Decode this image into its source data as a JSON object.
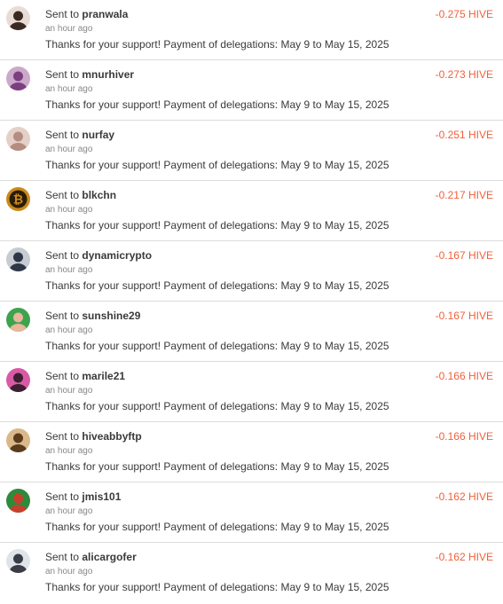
{
  "colors": {
    "amount": "#f0603c",
    "divider": "#dcdcdc"
  },
  "transactions": [
    {
      "prefix": "Sent to",
      "user": "pranwala",
      "time": "an hour ago",
      "memo": "Thanks for your support! Payment of delegations: May 9 to May 15, 2025",
      "amount": "-0.275 HIVE",
      "avatar_icon": "avatar-person-icon",
      "avatar_colors": [
        "#e8ddd5",
        "#3a2a22"
      ]
    },
    {
      "prefix": "Sent to",
      "user": "mnurhiver",
      "time": "an hour ago",
      "memo": "Thanks for your support! Payment of delegations: May 9 to May 15, 2025",
      "amount": "-0.273 HIVE",
      "avatar_icon": "avatar-person-icon",
      "avatar_colors": [
        "#caa9c9",
        "#7b3f80"
      ]
    },
    {
      "prefix": "Sent to",
      "user": "nurfay",
      "time": "an hour ago",
      "memo": "Thanks for your support! Payment of delegations: May 9 to May 15, 2025",
      "amount": "-0.251 HIVE",
      "avatar_icon": "avatar-person-icon",
      "avatar_colors": [
        "#e4d0c7",
        "#b58c80"
      ]
    },
    {
      "prefix": "Sent to",
      "user": "blkchn",
      "time": "an hour ago",
      "memo": "Thanks for your support! Payment of delegations: May 9 to May 15, 2025",
      "amount": "-0.217 HIVE",
      "avatar_icon": "bitcoin-icon",
      "avatar_colors": [
        "#c98a1a",
        "#2a1c08"
      ]
    },
    {
      "prefix": "Sent to",
      "user": "dynamicrypto",
      "time": "an hour ago",
      "memo": "Thanks for your support! Payment of delegations: May 9 to May 15, 2025",
      "amount": "-0.167 HIVE",
      "avatar_icon": "avatar-person-icon",
      "avatar_colors": [
        "#c7cbd2",
        "#2e3747"
      ]
    },
    {
      "prefix": "Sent to",
      "user": "sunshine29",
      "time": "an hour ago",
      "memo": "Thanks for your support! Payment of delegations: May 9 to May 15, 2025",
      "amount": "-0.167 HIVE",
      "avatar_icon": "avatar-person-icon",
      "avatar_colors": [
        "#3da34e",
        "#e9b79a"
      ]
    },
    {
      "prefix": "Sent to",
      "user": "marile21",
      "time": "an hour ago",
      "memo": "Thanks for your support! Payment of delegations: May 9 to May 15, 2025",
      "amount": "-0.166 HIVE",
      "avatar_icon": "avatar-person-icon",
      "avatar_colors": [
        "#d85aa5",
        "#3a2030"
      ]
    },
    {
      "prefix": "Sent to",
      "user": "hiveabbyftp",
      "time": "an hour ago",
      "memo": "Thanks for your support! Payment of delegations: May 9 to May 15, 2025",
      "amount": "-0.166 HIVE",
      "avatar_icon": "avatar-animal-icon",
      "avatar_colors": [
        "#d9b98a",
        "#5a3b1c"
      ]
    },
    {
      "prefix": "Sent to",
      "user": "jmis101",
      "time": "an hour ago",
      "memo": "Thanks for your support! Payment of delegations: May 9 to May 15, 2025",
      "amount": "-0.162 HIVE",
      "avatar_icon": "avatar-person-icon",
      "avatar_colors": [
        "#2e8a3c",
        "#c8402c"
      ]
    },
    {
      "prefix": "Sent to",
      "user": "alicargofer",
      "time": "an hour ago",
      "memo": "Thanks for your support! Payment of delegations: May 9 to May 15, 2025",
      "amount": "-0.162 HIVE",
      "avatar_icon": "avatar-person-icon",
      "avatar_colors": [
        "#dfe4ea",
        "#3a3d45"
      ]
    }
  ]
}
